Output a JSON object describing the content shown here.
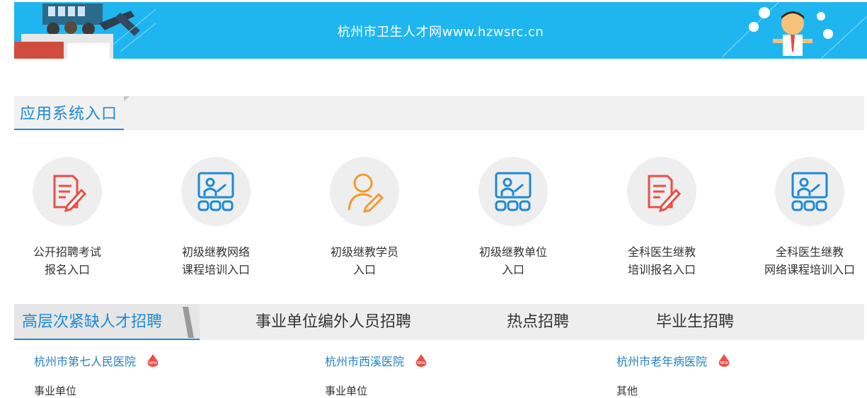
{
  "banner": {
    "title": "杭州市卫生人才网www.hzwsrc.cn",
    "bg": "#1fb6f0"
  },
  "section": {
    "title": "应用系统入口"
  },
  "entries": [
    {
      "line1": "公开招聘考试",
      "line2": "报名入口",
      "icon": "document-pen-icon",
      "color": "#e94f47"
    },
    {
      "line1": "初级继教网络",
      "line2": "课程培训入口",
      "icon": "classroom-icon",
      "color": "#1d8ad6"
    },
    {
      "line1": "初级继教学员",
      "line2": "入口",
      "icon": "person-pen-icon",
      "color": "#f39a2b"
    },
    {
      "line1": "初级继教单位",
      "line2": "入口",
      "icon": "classroom-icon",
      "color": "#1d8ad6"
    },
    {
      "line1": "全科医生继教",
      "line2": "培训报名入口",
      "icon": "document-pen-icon",
      "color": "#e94f47"
    },
    {
      "line1": "全科医生继教",
      "line2": "网络课程培训入口",
      "icon": "classroom-icon",
      "color": "#1d8ad6"
    }
  ],
  "tabs": [
    {
      "label": "高层次紧缺人才招聘",
      "active": true
    },
    {
      "label": "事业单位编外人员招聘",
      "active": false
    },
    {
      "label": "热点招聘",
      "active": false
    },
    {
      "label": "毕业生招聘",
      "active": false
    }
  ],
  "jobs": [
    {
      "name": "杭州市第七人民医院",
      "type": "事业单位"
    },
    {
      "name": "杭州市西溪医院",
      "type": "事业单位"
    },
    {
      "name": "杭州市老年病医院",
      "type": "其他"
    }
  ],
  "colors": {
    "accent": "#1d8ad6",
    "link": "#2180c5",
    "new_badge": "#e94f47"
  }
}
